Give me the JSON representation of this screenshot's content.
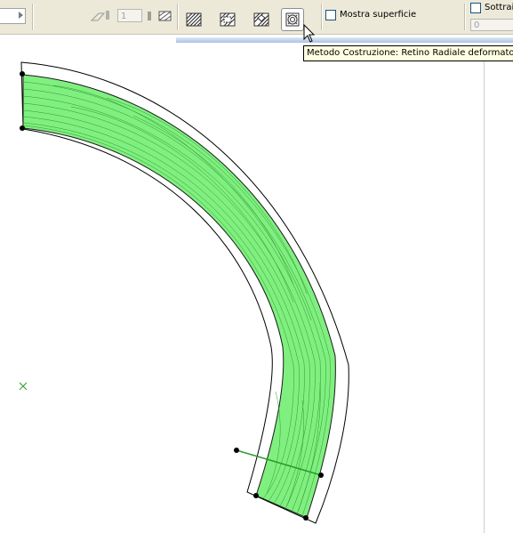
{
  "toolbar": {
    "pen_value": "1",
    "surface_label": "Mostra superficie",
    "subtract_label": "Sottrai",
    "subtract_value": "0"
  },
  "tooltip": {
    "text": "Metodo Costruzione: Retino Radiale deformato"
  },
  "colors": {
    "fill": "#7ff07f",
    "fill_lines": "#2a8a2a",
    "toolbar_bg": "#ece9d8",
    "tooltip_bg": "#ffffe1"
  }
}
